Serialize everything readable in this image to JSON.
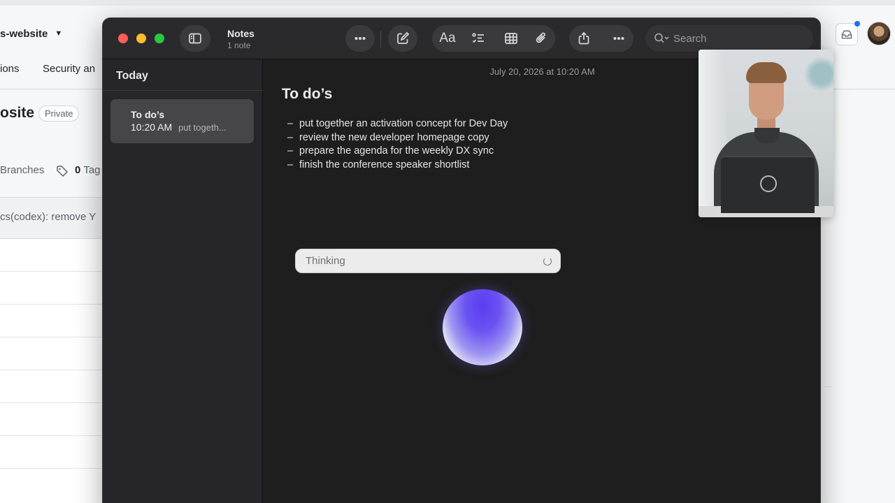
{
  "background_page": {
    "repo_name": "s-website",
    "nav_items": [
      "ions",
      "Security an"
    ],
    "title": "osite",
    "visibility_badge": "Private",
    "branches_label": "Branches",
    "tags_count": "0",
    "tags_label": "Tag",
    "latest_commit": "cs(codex): remove Y",
    "colors": {
      "page_bg": "#f6f7f8",
      "text": "#1f2328",
      "notification": "#1f6feb"
    }
  },
  "notes_window": {
    "title": "Notes",
    "subtitle": "1 note",
    "toolbar_icons": [
      "sidebar-toggle-icon",
      "more-icon",
      "compose-icon",
      "format-text-icon",
      "checklist-icon",
      "table-icon",
      "attachment-icon",
      "share-icon",
      "more-icon"
    ],
    "format_label": "Aa",
    "search": {
      "placeholder": "Search"
    },
    "sidebar": {
      "section_heading": "Today",
      "notes": [
        {
          "title": "To do’s",
          "time": "10:20 AM",
          "preview": "put togeth..."
        }
      ]
    },
    "editor": {
      "date": "July 20, 2026 at 10:20 AM",
      "title": "To do’s",
      "items": [
        "put together an activation concept for Dev Day",
        "review the new developer homepage copy",
        "prepare the agenda for the weekly DX sync",
        "finish the conference speaker shortlist"
      ],
      "bullet": "–"
    },
    "assistant": {
      "status_text": "Thinking"
    },
    "colors": {
      "window_bg": "#1e1e1e",
      "sidebar_bg": "#262629",
      "selected_note": "#464649",
      "traffic_red": "#ff5f57",
      "traffic_yellow": "#febc2e",
      "traffic_green": "#28c840",
      "orb": "#5b3df0"
    }
  },
  "webcam_overlay": {
    "logo_icon": "openai-logo-icon"
  }
}
